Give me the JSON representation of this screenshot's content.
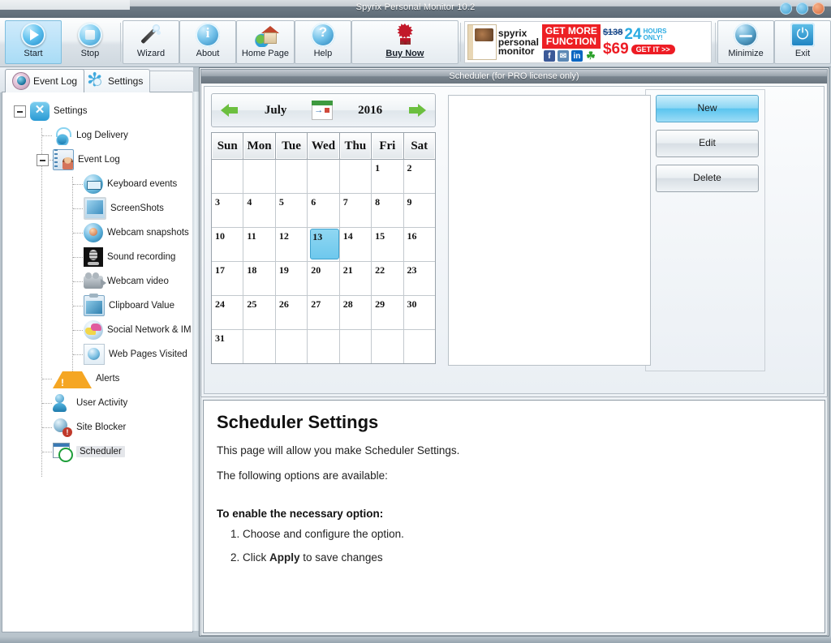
{
  "window": {
    "title": "Spyrix Personal Monitor 10.2",
    "controls": [
      {
        "name": "minimize-window",
        "color": "#3f9fd0"
      },
      {
        "name": "maximize-window",
        "color": "#3f9fd0"
      },
      {
        "name": "close-window",
        "color": "#d8693a"
      }
    ]
  },
  "toolbar": {
    "buttons": [
      {
        "id": "start",
        "label": "Start",
        "icon": "play-icon",
        "active": true,
        "framed": false
      },
      {
        "id": "stop",
        "label": "Stop",
        "icon": "stop-icon",
        "active": false,
        "framed": false
      },
      {
        "id": "wizard",
        "label": "Wizard",
        "icon": "wand-icon",
        "active": false,
        "framed": true
      },
      {
        "id": "about",
        "label": "About",
        "icon": "info-icon",
        "active": false,
        "framed": true
      },
      {
        "id": "home_page",
        "label": "Home Page",
        "icon": "home-icon",
        "active": false,
        "framed": true
      },
      {
        "id": "help",
        "label": "Help",
        "icon": "question-icon",
        "active": false,
        "framed": true
      },
      {
        "id": "buy_now",
        "label": "Buy Now",
        "icon": "cart-burst-icon",
        "active": false,
        "framed": true
      }
    ],
    "right_buttons": [
      {
        "id": "minimize",
        "label": "Minimize",
        "icon": "minimize-icon"
      },
      {
        "id": "exit",
        "label": "Exit",
        "icon": "power-icon"
      }
    ]
  },
  "banner": {
    "product_line1": "spyrix",
    "product_line2": "personal",
    "product_line3": "monitor",
    "promo_line1": "GET MORE",
    "promo_line2": "FUNCTION",
    "old_price": "$138",
    "hours_number": "24",
    "hours_line1": "HOURS",
    "hours_line2": "ONLY!",
    "price": "$69",
    "cta": "GET IT >>",
    "social": [
      {
        "name": "facebook-icon",
        "glyph": "f"
      },
      {
        "name": "vk-icon",
        "glyph": "✉"
      },
      {
        "name": "linkedin-icon",
        "glyph": "in"
      },
      {
        "name": "clover-icon",
        "glyph": "☘"
      }
    ]
  },
  "tabs": [
    {
      "id": "event_log",
      "label": "Event Log",
      "icon": "eye-icon",
      "active": false
    },
    {
      "id": "settings",
      "label": "Settings",
      "icon": "gear-icon",
      "active": true
    }
  ],
  "sidebar": {
    "tree": [
      {
        "id": "settings",
        "label": "Settings",
        "icon": "settings-x-icon",
        "level": 0,
        "expander": "collapse",
        "selected": false
      },
      {
        "id": "log_delivery",
        "label": "Log Delivery",
        "icon": "log-delivery-icon",
        "level": 1,
        "expander": "",
        "selected": false
      },
      {
        "id": "event_log",
        "label": "Event Log",
        "icon": "event-log-icon",
        "level": 1,
        "expander": "collapse",
        "selected": false
      },
      {
        "id": "keyboard_events",
        "label": "Keyboard events",
        "icon": "keyboard-icon",
        "level": 2,
        "expander": "",
        "selected": false
      },
      {
        "id": "screenshots",
        "label": "ScreenShots",
        "icon": "monitor-icon",
        "level": 2,
        "expander": "",
        "selected": false
      },
      {
        "id": "webcam_snapshots",
        "label": "Webcam snapshots",
        "icon": "webcam-icon",
        "level": 2,
        "expander": "",
        "selected": false
      },
      {
        "id": "sound_recording",
        "label": "Sound recording",
        "icon": "microphone-icon",
        "level": 2,
        "expander": "",
        "selected": false
      },
      {
        "id": "webcam_video",
        "label": "Webcam video",
        "icon": "camcorder-icon",
        "level": 2,
        "expander": "",
        "selected": false
      },
      {
        "id": "clipboard_value",
        "label": "Clipboard Value",
        "icon": "clipboard-icon",
        "level": 2,
        "expander": "",
        "selected": false
      },
      {
        "id": "social_network",
        "label": "Social Network & IM",
        "icon": "chat-icon",
        "level": 2,
        "expander": "",
        "selected": false
      },
      {
        "id": "web_pages",
        "label": "Web Pages Visited",
        "icon": "globe-page-icon",
        "level": 2,
        "expander": "",
        "selected": false
      },
      {
        "id": "alerts",
        "label": "Alerts",
        "icon": "warning-triangle-icon",
        "level": 1,
        "expander": "",
        "selected": false
      },
      {
        "id": "user_activity",
        "label": "User Activity",
        "icon": "user-clock-icon",
        "level": 1,
        "expander": "",
        "selected": false
      },
      {
        "id": "site_blocker",
        "label": "Site Blocker",
        "icon": "globe-block-icon",
        "level": 1,
        "expander": "",
        "selected": false
      },
      {
        "id": "scheduler",
        "label": "Scheduler",
        "icon": "calendar-clock-icon",
        "level": 1,
        "expander": "",
        "selected": true
      }
    ]
  },
  "scheduler_panel": {
    "header": "Scheduler (for PRO license only)",
    "calendar": {
      "month": "July",
      "year": "2016",
      "prev_icon": "arrow-left-icon",
      "next_icon": "arrow-right-icon",
      "today_icon": "goto-today-icon",
      "weekdays": [
        "Sun",
        "Mon",
        "Tue",
        "Wed",
        "Thu",
        "Fri",
        "Sat"
      ],
      "selected_day": 13,
      "weeks": [
        [
          "",
          "",
          "",
          "",
          "",
          "1",
          "2"
        ],
        [
          "3",
          "4",
          "5",
          "6",
          "7",
          "8",
          "9"
        ],
        [
          "10",
          "11",
          "12",
          "13",
          "14",
          "15",
          "16"
        ],
        [
          "17",
          "18",
          "19",
          "20",
          "21",
          "22",
          "23"
        ],
        [
          "24",
          "25",
          "26",
          "27",
          "28",
          "29",
          "30"
        ],
        [
          "31",
          "",
          "",
          "",
          "",
          "",
          ""
        ]
      ]
    },
    "list_items": [],
    "buttons": [
      {
        "id": "new",
        "label": "New",
        "primary": true
      },
      {
        "id": "edit",
        "label": "Edit",
        "primary": false
      },
      {
        "id": "delete",
        "label": "Delete",
        "primary": false
      }
    ]
  },
  "doc": {
    "title": "Scheduler Settings",
    "paragraph1": "This page will allow you make Scheduler Settings.",
    "paragraph2": "The following options are available:",
    "subtitle": "To enable the necessary option:",
    "step1": "Choose and configure the option.",
    "step2_prefix": "Click ",
    "step2_bold": "Apply",
    "step2_suffix": " to save changes"
  },
  "colors": {
    "accent_blue": "#59c4ef",
    "promo_red": "#ed1c24",
    "title_bar": "#5e6b76",
    "selection": "#8fd7f2"
  }
}
